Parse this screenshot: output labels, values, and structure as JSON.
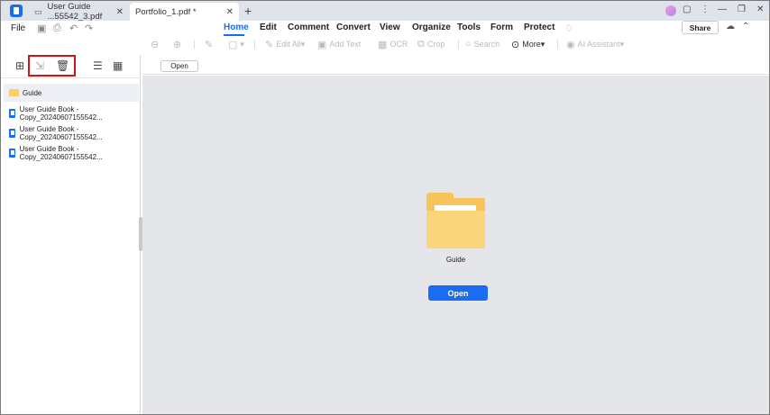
{
  "tabs": [
    {
      "label": "User Guide ...55542_3.pdf"
    },
    {
      "label": "Portfolio_1.pdf *"
    }
  ],
  "menu": {
    "file": "File",
    "items": [
      "Home",
      "Edit",
      "Comment",
      "Convert",
      "View",
      "Organize",
      "Tools",
      "Form",
      "Protect"
    ],
    "active": "Home",
    "share": "Share"
  },
  "toolbar": {
    "edit_all": "Edit All",
    "add_text": "Add Text",
    "ocr": "OCR",
    "crop": "Crop",
    "search": "Search",
    "more": "More",
    "ai_assistant": "AI Assistant"
  },
  "panel": {
    "items": [
      {
        "label": "Guide",
        "type": "folder"
      },
      {
        "label": "User Guide Book - Copy_20240607155542...",
        "type": "pdf"
      },
      {
        "label": "User Guide Book - Copy_20240607155542...",
        "type": "pdf"
      },
      {
        "label": "User Guide Book - Copy_20240607155542...",
        "type": "pdf"
      }
    ]
  },
  "content": {
    "open_small": "Open",
    "folder_name": "Guide",
    "open_button": "Open"
  },
  "colors": {
    "accent": "#1a6cf3",
    "highlight_box": "#d0141a",
    "folder": "#f6c45b",
    "content_bg": "#e5e6ea"
  }
}
